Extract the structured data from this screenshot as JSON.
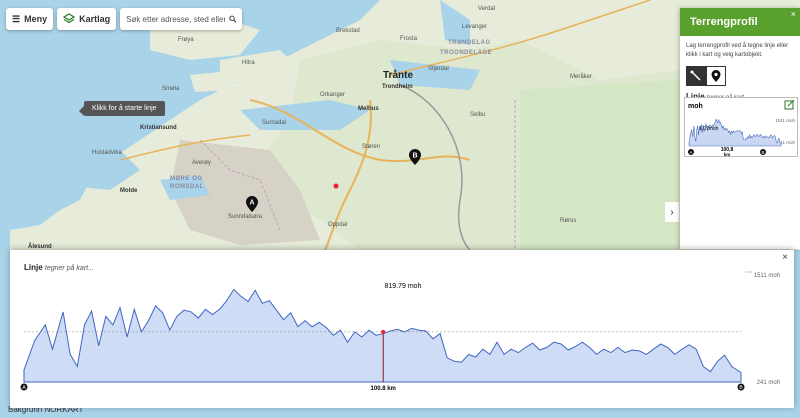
{
  "toolbar": {
    "menu_label": "Meny",
    "maptype_label": "Kartlag",
    "search_placeholder": "Søk etter adresse, sted eller eiendom"
  },
  "map": {
    "tooltip": "Klikk for å starte linje",
    "labels": [
      {
        "text": "Frøya",
        "cls": ""
      },
      {
        "text": "Hitra",
        "cls": ""
      },
      {
        "text": "Smøla",
        "cls": ""
      },
      {
        "text": "Kristiansund",
        "cls": "b"
      },
      {
        "text": "Orkanger",
        "cls": ""
      },
      {
        "text": "Melhus",
        "cls": "b"
      },
      {
        "text": "Trondheim",
        "cls": "b"
      },
      {
        "text": "Trånte",
        "cls": "city"
      },
      {
        "text": "Stjørdal",
        "cls": ""
      },
      {
        "text": "Levanger",
        "cls": ""
      },
      {
        "text": "Verdal",
        "cls": ""
      },
      {
        "text": "TRØNDELAG",
        "cls": "region"
      },
      {
        "text": "TROONDELAGE",
        "cls": "region"
      },
      {
        "text": "MØRE OG",
        "cls": "region"
      },
      {
        "text": "ROMSDAL",
        "cls": "region"
      },
      {
        "text": "Molde",
        "cls": "b"
      },
      {
        "text": "Sunndalsøra",
        "cls": ""
      },
      {
        "text": "Oppdal",
        "cls": ""
      },
      {
        "text": "Røros",
        "cls": ""
      },
      {
        "text": "Støren",
        "cls": ""
      },
      {
        "text": "Ålesund",
        "cls": "b"
      },
      {
        "text": "Averøy",
        "cls": ""
      },
      {
        "text": "Selbu",
        "cls": ""
      },
      {
        "text": "Meråker",
        "cls": ""
      },
      {
        "text": "Surnadal",
        "cls": ""
      },
      {
        "text": "Hustadvika",
        "cls": ""
      },
      {
        "text": "Brekstad",
        "cls": ""
      },
      {
        "text": "Frosta",
        "cls": ""
      }
    ],
    "pin_a": "A",
    "pin_b": "B",
    "bottom_text": "Bakgrunn  NORKART"
  },
  "panel": {
    "title": "Terrengprofil",
    "close": "×",
    "description": "Lag terrengprofil ved å tegne linje eller klikk i kart og velg kartobjekt.",
    "line_label": "Linje",
    "line_hint": "tegner på kart...",
    "mini": {
      "unit": "moh",
      "max_label": "1511 moh",
      "min_label": "241 moh",
      "current": "1,07moh",
      "distance": "100,8",
      "distance_unit": "km",
      "start": "A",
      "end": "B"
    },
    "collapse": "›"
  },
  "profile": {
    "title": "Linje",
    "hint": "tegner på kart...",
    "close": "×",
    "hover_value": "819.79 moh",
    "max_label": "1511 moh",
    "min_label": "241 moh",
    "distance_label": "100.8 km",
    "start": "A",
    "end": "B"
  },
  "chart_data": {
    "type": "area",
    "title": "",
    "xlabel": "",
    "ylabel": "",
    "ylim": [
      241,
      1511
    ],
    "xlim": [
      0,
      100.8
    ],
    "series": [
      {
        "values": [
          [
            0,
            380
          ],
          [
            1.5,
            720
          ],
          [
            3,
            900
          ],
          [
            4,
            620
          ],
          [
            5.5,
            1050
          ],
          [
            6.5,
            560
          ],
          [
            7.5,
            420
          ],
          [
            8.5,
            900
          ],
          [
            9.5,
            1060
          ],
          [
            10.5,
            660
          ],
          [
            11.5,
            1000
          ],
          [
            12.5,
            900
          ],
          [
            13.5,
            1100
          ],
          [
            14.5,
            760
          ],
          [
            15.5,
            1080
          ],
          [
            16.5,
            820
          ],
          [
            17.5,
            950
          ],
          [
            18.5,
            1120
          ],
          [
            19.5,
            1040
          ],
          [
            20.5,
            840
          ],
          [
            21.5,
            1000
          ],
          [
            22.5,
            1070
          ],
          [
            23.5,
            1050
          ],
          [
            24.5,
            980
          ],
          [
            25.5,
            1080
          ],
          [
            26.5,
            1020
          ],
          [
            27.5,
            1080
          ],
          [
            28.5,
            1180
          ],
          [
            29.5,
            1310
          ],
          [
            30.5,
            1230
          ],
          [
            31.5,
            1170
          ],
          [
            32.5,
            1300
          ],
          [
            33.5,
            1150
          ],
          [
            34.5,
            1180
          ],
          [
            35.5,
            1070
          ],
          [
            36.5,
            960
          ],
          [
            37.5,
            1040
          ],
          [
            38.5,
            880
          ],
          [
            39.5,
            950
          ],
          [
            40.5,
            880
          ],
          [
            41.5,
            930
          ],
          [
            42.5,
            870
          ],
          [
            43.5,
            780
          ],
          [
            44.5,
            840
          ],
          [
            45.5,
            700
          ],
          [
            46.5,
            820
          ],
          [
            47.5,
            760
          ],
          [
            48.5,
            840
          ],
          [
            49.5,
            780
          ],
          [
            50.5,
            800
          ],
          [
            51.5,
            830
          ],
          [
            52.5,
            850
          ],
          [
            53.5,
            820
          ],
          [
            54.5,
            860
          ],
          [
            55.5,
            840
          ],
          [
            56.5,
            830
          ],
          [
            57.5,
            740
          ],
          [
            58.5,
            800
          ],
          [
            59.5,
            520
          ],
          [
            60.5,
            480
          ],
          [
            61.5,
            470
          ],
          [
            62.5,
            560
          ],
          [
            63.5,
            530
          ],
          [
            64.5,
            620
          ],
          [
            65.5,
            560
          ],
          [
            66.5,
            700
          ],
          [
            67.5,
            560
          ],
          [
            68.5,
            620
          ],
          [
            69.5,
            580
          ],
          [
            70.5,
            640
          ],
          [
            71.5,
            690
          ],
          [
            72.5,
            610
          ],
          [
            73.5,
            640
          ],
          [
            74.5,
            700
          ],
          [
            75.5,
            680
          ],
          [
            76.5,
            610
          ],
          [
            77.5,
            650
          ],
          [
            78.5,
            700
          ],
          [
            79.5,
            640
          ],
          [
            80.5,
            560
          ],
          [
            81.5,
            620
          ],
          [
            82.5,
            580
          ],
          [
            83.5,
            640
          ],
          [
            84.5,
            580
          ],
          [
            85.5,
            610
          ],
          [
            86.5,
            600
          ],
          [
            87.5,
            560
          ],
          [
            88.5,
            620
          ],
          [
            89.5,
            680
          ],
          [
            90.5,
            640
          ],
          [
            91.5,
            560
          ],
          [
            92.5,
            620
          ],
          [
            93.5,
            670
          ],
          [
            94.5,
            620
          ],
          [
            95.5,
            420
          ],
          [
            96.5,
            360
          ],
          [
            97.5,
            480
          ],
          [
            98.5,
            550
          ],
          [
            99.5,
            420
          ],
          [
            100.8,
            350
          ]
        ]
      }
    ],
    "mean_line": 819.79,
    "marker_x": 50.5
  }
}
